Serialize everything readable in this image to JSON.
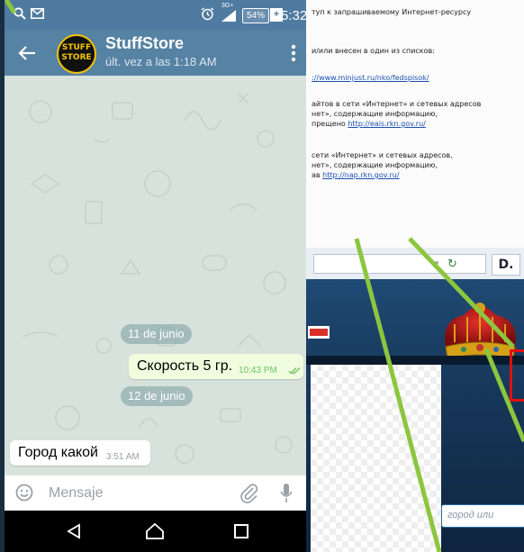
{
  "status_bar": {
    "network": "3G+",
    "battery": "54%",
    "battery_charging": "+",
    "time": "5:32",
    "icons": [
      "search-icon",
      "mail-icon",
      "alarm-icon",
      "signal-icon",
      "battery-icon"
    ]
  },
  "chat_header": {
    "avatar_text": "STUFF STORE",
    "name": "StuffStore",
    "status": "últ. vez a las 1:18 AM",
    "icons": [
      "back-arrow-icon",
      "more-vert-icon"
    ]
  },
  "messages": [
    {
      "type": "date",
      "text": "11 de junio"
    },
    {
      "type": "outgoing",
      "text": "Скорость 5 гр.",
      "time": "10:43 PM",
      "status_icon": "double-check-icon"
    },
    {
      "type": "date",
      "text": "12 de junio"
    },
    {
      "type": "incoming",
      "text": "Город какой",
      "time": "3:51 AM"
    }
  ],
  "input_bar": {
    "placeholder": "Mensaje",
    "icons": [
      "emoji-icon",
      "paperclip-icon",
      "microphone-icon"
    ]
  },
  "nav_bar": {
    "icons": [
      "nav-back-icon",
      "nav-home-icon",
      "nav-recent-icon"
    ]
  },
  "background_document": {
    "lines": [
      "туп к запрашиваемому Интернет-ресурсу",
      "и/или внесен в один из списков:",
      "айтов в сети «Интернет» и сетевых адресов",
      "нет», содержащие информацию,",
      "сети «Интернет» и сетевых адресов,",
      "нет», содержащие информацию,"
    ],
    "link_1": "://www.minjust.ru/nko/fedspisok/",
    "line_3_prefix": "прещено ",
    "link_2": "http://eais.rkn.gov.ru/",
    "line_6_prefix": "ав ",
    "link_3": "http://nap.rkn.gov.ru/"
  },
  "background_browser": {
    "reload_icon": "reload-icon",
    "logo_letter": "D.",
    "search_placeholder": "город или"
  },
  "colors": {
    "header": "#5682a3",
    "status_bar": "#4f7ba0",
    "chat_background": "#d7e2dc",
    "outgoing_bubble": "#effdde",
    "incoming_bubble": "#ffffff",
    "check_marks": "#6cc264",
    "overlay_lines": "#8cc63f"
  }
}
